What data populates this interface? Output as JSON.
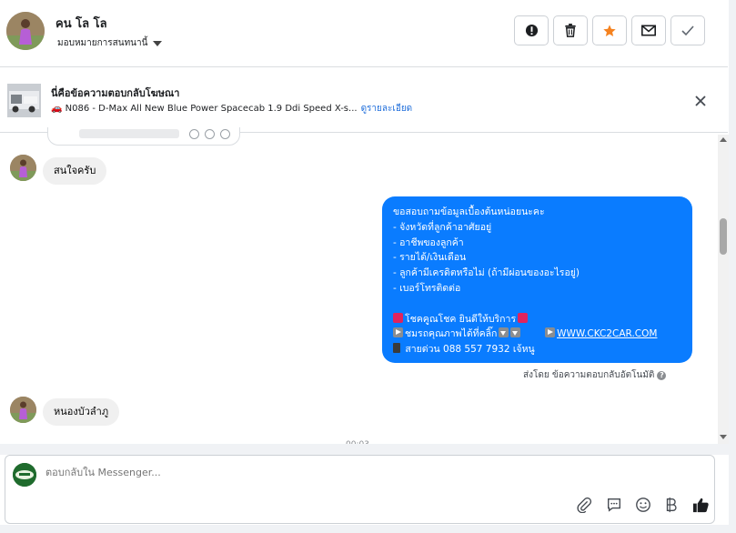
{
  "header": {
    "contact_name": "คน โล โล",
    "assign_label": "มอบหมายการสนทนานี้",
    "buttons": [
      {
        "name": "mark-spam",
        "icon": "alert-icon"
      },
      {
        "name": "delete",
        "icon": "trash-icon"
      },
      {
        "name": "star",
        "icon": "star-icon"
      },
      {
        "name": "mark-unread",
        "icon": "envelope-icon"
      },
      {
        "name": "mark-done",
        "icon": "check-icon"
      }
    ]
  },
  "ad_banner": {
    "title": "นี่คือข้อความตอบกลับโฆษณา",
    "subtitle": "🚗 N086 - D-Max All New Blue Power Spacecab 1.9 Ddi Speed X-s...",
    "link": "ดูรายละเอียด"
  },
  "messages": {
    "incoming": [
      {
        "text": "สนใจครับ"
      },
      {
        "text": "หนองบัวลำภู"
      }
    ],
    "outgoing": {
      "lines": [
        "ขอสอบถามข้อมูลเบื้องต้นหน่อยนะคะ",
        "- จังหวัดที่ลูกค้าอาศัยอยู่",
        "- อาชีพของลูกค้า",
        "- รายได้/เงินเดือน",
        "- ลูกค้ามีเครดิตหรือไม่ (ถ้ามีผ่อนของอะไรอยู่)",
        "- เบอร์โทรติดต่อ"
      ],
      "promo": "โชคคูณโชค ยินดีให้บริการ",
      "gallery": "ชมรถคุณภาพได้ที่คลิ๊ก",
      "website": "WWW.CKC2CAR.COM",
      "hotline": "สายด่วน 088 557 7932 เจ้หนู"
    },
    "sent_by": "ส่งโดย ข้อความตอบกลับอัตโนมัติ",
    "timestamp_partial": "00:03"
  },
  "composer": {
    "placeholder": "ตอบกลับใน Messenger...",
    "tools": [
      "paperclip-icon",
      "saved-reply-icon",
      "emoji-icon",
      "baht-icon",
      "like-icon"
    ]
  },
  "colors": {
    "outgoing_bubble": "#0a7cff",
    "incoming_bubble": "#f0f0f0",
    "star": "#f5821f",
    "link": "#216fdb"
  }
}
